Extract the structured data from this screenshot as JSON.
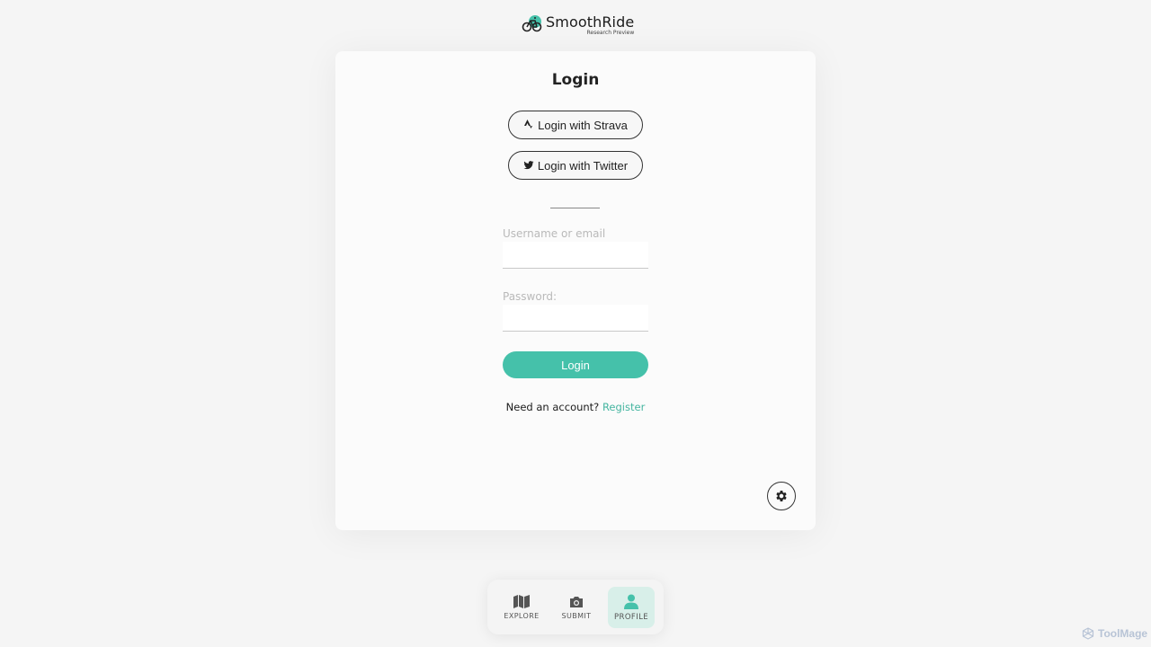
{
  "header": {
    "brand": "SmoothRide",
    "subtitle": "Research Preview",
    "logo_icon": "bicycle-icon"
  },
  "login_card": {
    "title": "Login",
    "strava_label": "Login with Strava",
    "twitter_label": "Login with Twitter",
    "username_label": "Username or email",
    "username_value": "",
    "password_label": "Password:",
    "password_value": "",
    "submit_label": "Login",
    "register_prompt": "Need an account?",
    "register_link": "Register",
    "settings_icon": "gear-icon"
  },
  "bottom_nav": {
    "items": [
      {
        "label": "EXPLORE",
        "icon": "map-icon",
        "active": false
      },
      {
        "label": "SUBMIT",
        "icon": "camera-icon",
        "active": false
      },
      {
        "label": "PROFILE",
        "icon": "user-icon",
        "active": true
      }
    ]
  },
  "watermark": {
    "text": "ToolMage"
  },
  "colors": {
    "accent": "#45c1aa",
    "accent_soft": "#d8efe9",
    "background": "#f5f5f5",
    "card": "#fbfbfb"
  }
}
